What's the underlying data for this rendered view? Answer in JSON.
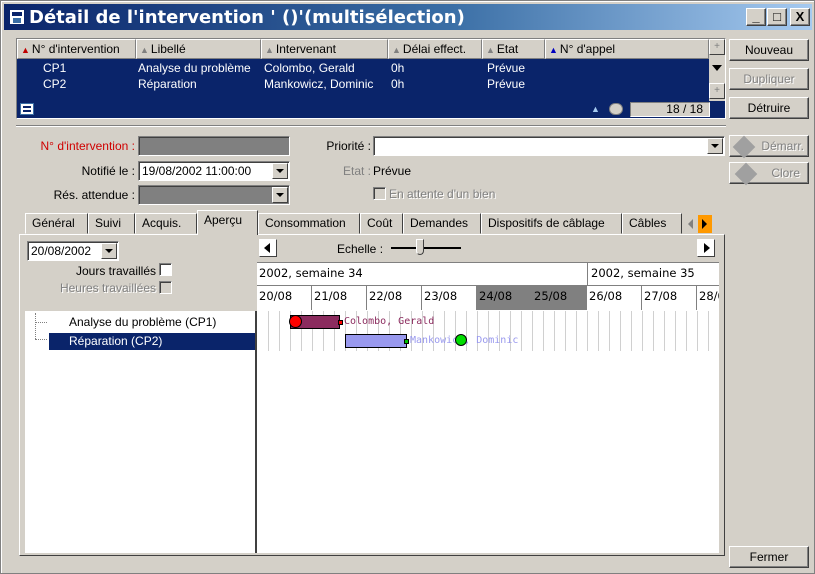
{
  "window": {
    "title": "Détail de l'intervention ' ()'(multisélection)",
    "controls": [
      "_",
      "□",
      "X"
    ]
  },
  "list": {
    "columns": [
      "N° d'intervention",
      "Libellé",
      "Intervenant",
      "Délai effect.",
      "Etat",
      "N° d'appel"
    ],
    "rows": [
      [
        "CP1",
        "Analyse du problème",
        "Colombo, Gerald",
        "0h",
        "Prévue",
        ""
      ],
      [
        "CP2",
        "Réparation",
        "Mankowicz, Dominic",
        "0h",
        "Prévue",
        ""
      ]
    ],
    "counter": "18 / 18"
  },
  "side_buttons": {
    "nouveau": "Nouveau",
    "dupliquer": "Dupliquer",
    "detruire": "Détruire",
    "demarrer": "Démarr.",
    "clore": "Clore",
    "fermer": "Fermer"
  },
  "form": {
    "num_label": "N° d'intervention :",
    "num_value": "",
    "notifie_label": "Notifié le :",
    "notifie_value": "19/08/2002 11:00:00",
    "res_label": "Rés. attendue :",
    "res_value": "",
    "priorite_label": "Priorité :",
    "priorite_value": "",
    "etat_label": "Etat :",
    "etat_value": "Prévue",
    "attente_label": "En attente d'un bien"
  },
  "tabs": [
    "Général",
    "Suivi",
    "Acquis.",
    "Aperçu",
    "Consommation",
    "Coût",
    "Demandes",
    "Dispositifs de câblage",
    "Câbles"
  ],
  "active_tab": "Aperçu",
  "overview": {
    "date_value": "20/08/2002",
    "jours_label": "Jours travaillés",
    "heures_label": "Heures travaillées",
    "echelle_label": "Echelle :",
    "weeks": [
      "2002, semaine 34",
      "2002, semaine 35"
    ],
    "days": [
      "20/08",
      "21/08",
      "22/08",
      "23/08",
      "24/08",
      "25/08",
      "26/08",
      "27/08",
      "28/0"
    ],
    "tree_items": [
      "Analyse du problème (CP1)",
      "Réparation (CP2)"
    ],
    "bars": [
      {
        "label": "Colombo, Gerald",
        "color": "#8b2b5e"
      },
      {
        "label": "Mankowicz, Dominic",
        "color": "#9999ee"
      }
    ]
  },
  "colors": {
    "selection": "#0a246a",
    "face": "#d4d0c8"
  }
}
